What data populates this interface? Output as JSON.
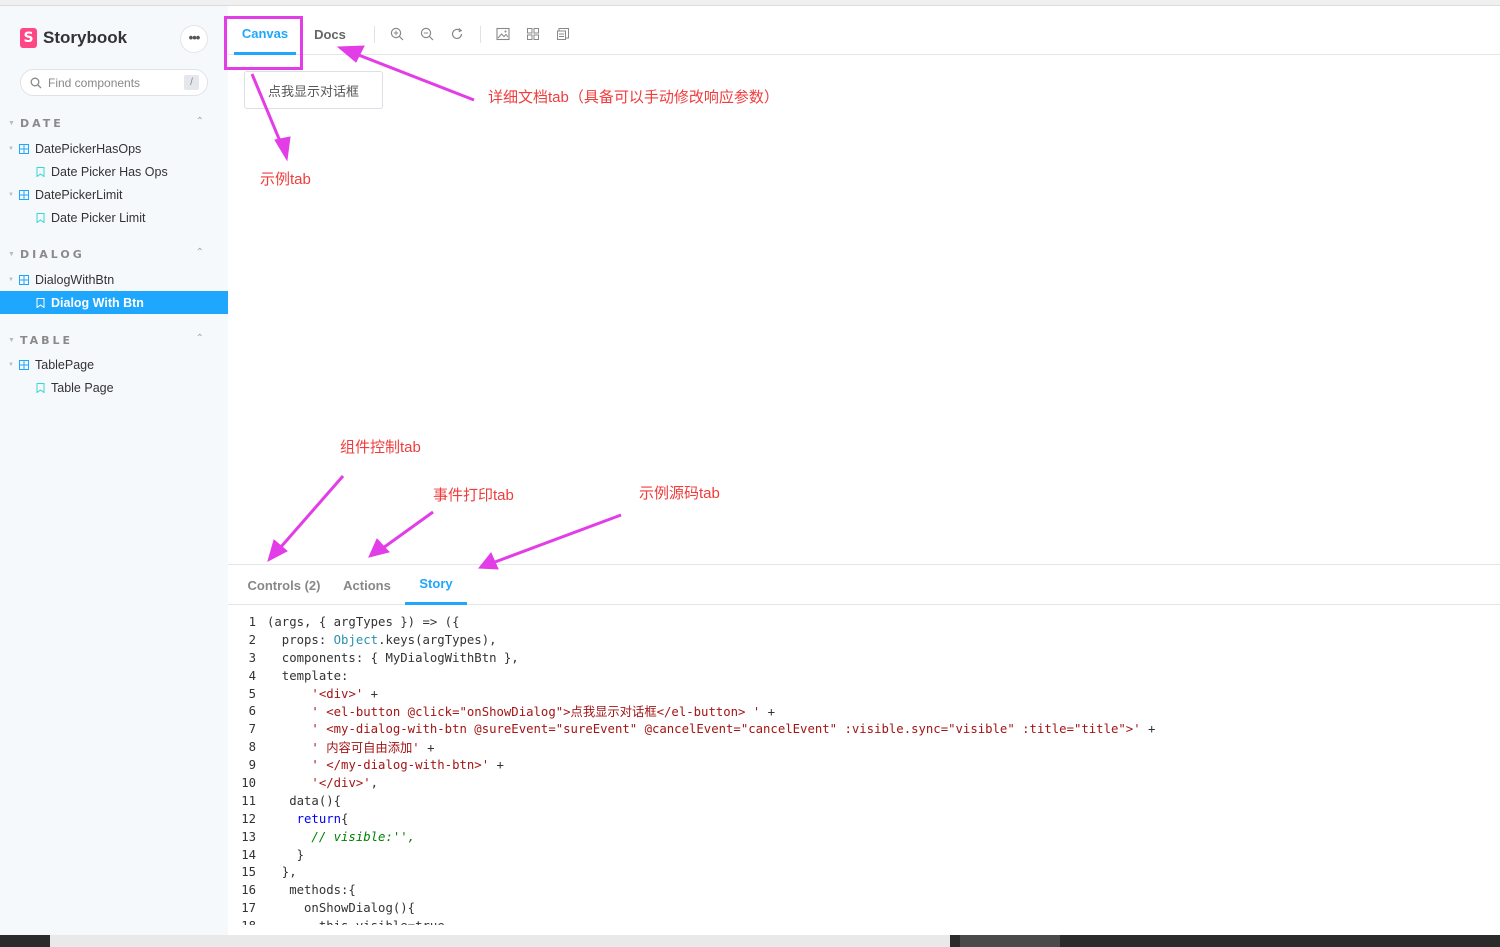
{
  "sidebar": {
    "brand": "Storybook",
    "brand_mark": "S",
    "more_label": "•••",
    "search_placeholder": "Find components",
    "search_shortcut": "/",
    "sections": [
      {
        "title": "DATE",
        "items": [
          {
            "label": "DatePickerHasOps",
            "type": "component"
          },
          {
            "label": "Date Picker Has Ops",
            "type": "story"
          },
          {
            "label": "DatePickerLimit",
            "type": "component"
          },
          {
            "label": "Date Picker Limit",
            "type": "story"
          }
        ]
      },
      {
        "title": "DIALOG",
        "items": [
          {
            "label": "DialogWithBtn",
            "type": "component"
          },
          {
            "label": "Dialog With Btn",
            "type": "story",
            "selected": true
          }
        ]
      },
      {
        "title": "TABLE",
        "items": [
          {
            "label": "TablePage",
            "type": "component"
          },
          {
            "label": "Table Page",
            "type": "story"
          }
        ]
      }
    ]
  },
  "toolbar": {
    "tabs": [
      {
        "label": "Canvas",
        "active": true
      },
      {
        "label": "Docs",
        "active": false
      }
    ],
    "tools": [
      "zoom-in-icon",
      "zoom-out-icon",
      "reset-zoom-icon",
      "background-icon",
      "grid-icon",
      "viewport-icon"
    ]
  },
  "preview": {
    "button_label": "点我显示对话框"
  },
  "annotations": {
    "docs_tab": "详细文档tab（具备可以手动修改响应参数）",
    "canvas_tab": "示例tab",
    "controls_tab": "组件控制tab",
    "actions_tab": "事件打印tab",
    "story_tab": "示例源码tab",
    "arrow_color": "#e23de6",
    "text_color": "#f03c3c"
  },
  "addons": {
    "tabs": [
      {
        "label": "Controls (2)",
        "active": false
      },
      {
        "label": "Actions",
        "active": false
      },
      {
        "label": "Story",
        "active": true
      }
    ],
    "code_lines": [
      "(args, { argTypes }) => ({",
      "  props: Object.keys(argTypes),",
      "  components: { MyDialogWithBtn },",
      "  template:",
      "      '<div>' +",
      "      ' <el-button @click=\"onShowDialog\">点我显示对话框</el-button> ' +",
      "      ' <my-dialog-with-btn @sureEvent=\"sureEvent\" @cancelEvent=\"cancelEvent\" :visible.sync=\"visible\" :title=\"title\">' +",
      "      ' 内容可自由添加' +",
      "      ' </my-dialog-with-btn>' +",
      "      '</div>',",
      "   data(){",
      "    return{",
      "      // visible:'',",
      "    }",
      "  },",
      "   methods:{",
      "     onShowDialog(){",
      "       this.visible=true"
    ]
  },
  "colors": {
    "accent": "#1ea7fd",
    "brand": "#ff4785",
    "sidebar_bg": "#f6f9fc"
  }
}
